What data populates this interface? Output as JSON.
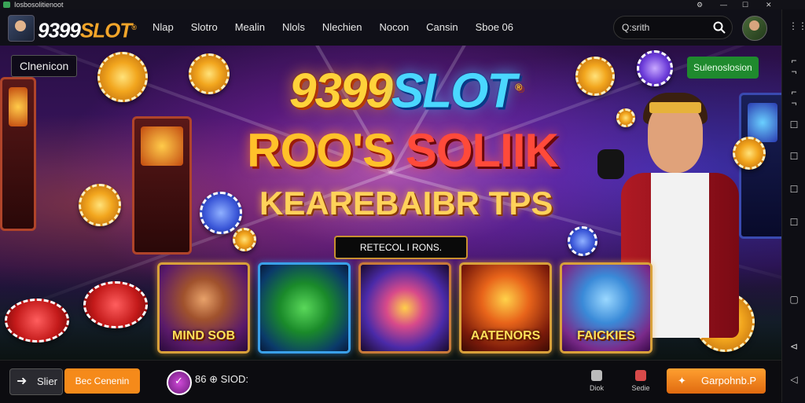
{
  "window": {
    "title": "Iosbosolitienoot",
    "controls": [
      "⚙",
      "—",
      "☐",
      "✕"
    ]
  },
  "header": {
    "logo": {
      "number": "9399",
      "word": "SLOT",
      "mark": "®"
    },
    "nav": [
      "Nlap",
      "Slotro",
      "Mealin",
      "Nlols",
      "Nlechien",
      "Nocon",
      "Cansin",
      "Sboe 06"
    ],
    "search": {
      "placeholder": "Q:srith"
    }
  },
  "side_rail": {
    "icons": [
      "⋮⋮",
      "⌐ ¬",
      "⌐ ¬",
      "☐",
      "☐",
      "☐",
      "☐",
      "▢",
      "⊲",
      "◁"
    ]
  },
  "hero": {
    "badge_left": "Clnenicon",
    "badge_right": "Sulenoslosion",
    "headline1_a": "9399",
    "headline1_b": "SLOT",
    "headline1_mark": "®",
    "headline2_a": "ROO'S",
    "headline2_b": "SOLIIK",
    "headline3": "KEAREBAIBR TPS",
    "tagline": "RETECOL I RONS."
  },
  "games": [
    {
      "title": "MIND SOB"
    },
    {
      "title": ""
    },
    {
      "title": ""
    },
    {
      "title": "AATENORS"
    },
    {
      "title": "FAICKIES"
    }
  ],
  "bottom": {
    "back_label": "Slier",
    "orange_label": "Bec Cenenin",
    "mini_text": "86 ⊕ SIOD:",
    "icon1_label": "Diok",
    "icon2_label": "Sedie",
    "play_label": "Garpohnb.P",
    "colors": {
      "accent": "#f58a1a",
      "green": "#1f8a2e"
    }
  }
}
